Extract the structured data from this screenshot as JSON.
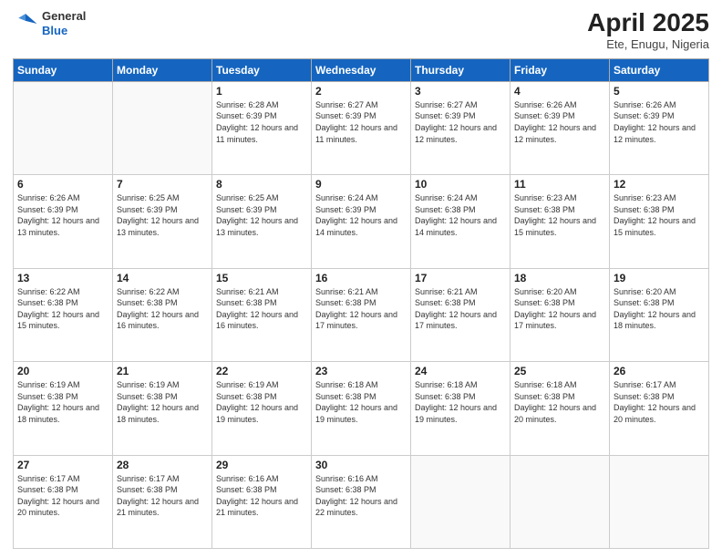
{
  "header": {
    "logo_general": "General",
    "logo_blue": "Blue",
    "month_year": "April 2025",
    "location": "Ete, Enugu, Nigeria"
  },
  "days_of_week": [
    "Sunday",
    "Monday",
    "Tuesday",
    "Wednesday",
    "Thursday",
    "Friday",
    "Saturday"
  ],
  "weeks": [
    [
      {
        "day": "",
        "info": ""
      },
      {
        "day": "",
        "info": ""
      },
      {
        "day": "1",
        "info": "Sunrise: 6:28 AM\nSunset: 6:39 PM\nDaylight: 12 hours and 11 minutes."
      },
      {
        "day": "2",
        "info": "Sunrise: 6:27 AM\nSunset: 6:39 PM\nDaylight: 12 hours and 11 minutes."
      },
      {
        "day": "3",
        "info": "Sunrise: 6:27 AM\nSunset: 6:39 PM\nDaylight: 12 hours and 12 minutes."
      },
      {
        "day": "4",
        "info": "Sunrise: 6:26 AM\nSunset: 6:39 PM\nDaylight: 12 hours and 12 minutes."
      },
      {
        "day": "5",
        "info": "Sunrise: 6:26 AM\nSunset: 6:39 PM\nDaylight: 12 hours and 12 minutes."
      }
    ],
    [
      {
        "day": "6",
        "info": "Sunrise: 6:26 AM\nSunset: 6:39 PM\nDaylight: 12 hours and 13 minutes."
      },
      {
        "day": "7",
        "info": "Sunrise: 6:25 AM\nSunset: 6:39 PM\nDaylight: 12 hours and 13 minutes."
      },
      {
        "day": "8",
        "info": "Sunrise: 6:25 AM\nSunset: 6:39 PM\nDaylight: 12 hours and 13 minutes."
      },
      {
        "day": "9",
        "info": "Sunrise: 6:24 AM\nSunset: 6:39 PM\nDaylight: 12 hours and 14 minutes."
      },
      {
        "day": "10",
        "info": "Sunrise: 6:24 AM\nSunset: 6:38 PM\nDaylight: 12 hours and 14 minutes."
      },
      {
        "day": "11",
        "info": "Sunrise: 6:23 AM\nSunset: 6:38 PM\nDaylight: 12 hours and 15 minutes."
      },
      {
        "day": "12",
        "info": "Sunrise: 6:23 AM\nSunset: 6:38 PM\nDaylight: 12 hours and 15 minutes."
      }
    ],
    [
      {
        "day": "13",
        "info": "Sunrise: 6:22 AM\nSunset: 6:38 PM\nDaylight: 12 hours and 15 minutes."
      },
      {
        "day": "14",
        "info": "Sunrise: 6:22 AM\nSunset: 6:38 PM\nDaylight: 12 hours and 16 minutes."
      },
      {
        "day": "15",
        "info": "Sunrise: 6:21 AM\nSunset: 6:38 PM\nDaylight: 12 hours and 16 minutes."
      },
      {
        "day": "16",
        "info": "Sunrise: 6:21 AM\nSunset: 6:38 PM\nDaylight: 12 hours and 17 minutes."
      },
      {
        "day": "17",
        "info": "Sunrise: 6:21 AM\nSunset: 6:38 PM\nDaylight: 12 hours and 17 minutes."
      },
      {
        "day": "18",
        "info": "Sunrise: 6:20 AM\nSunset: 6:38 PM\nDaylight: 12 hours and 17 minutes."
      },
      {
        "day": "19",
        "info": "Sunrise: 6:20 AM\nSunset: 6:38 PM\nDaylight: 12 hours and 18 minutes."
      }
    ],
    [
      {
        "day": "20",
        "info": "Sunrise: 6:19 AM\nSunset: 6:38 PM\nDaylight: 12 hours and 18 minutes."
      },
      {
        "day": "21",
        "info": "Sunrise: 6:19 AM\nSunset: 6:38 PM\nDaylight: 12 hours and 18 minutes."
      },
      {
        "day": "22",
        "info": "Sunrise: 6:19 AM\nSunset: 6:38 PM\nDaylight: 12 hours and 19 minutes."
      },
      {
        "day": "23",
        "info": "Sunrise: 6:18 AM\nSunset: 6:38 PM\nDaylight: 12 hours and 19 minutes."
      },
      {
        "day": "24",
        "info": "Sunrise: 6:18 AM\nSunset: 6:38 PM\nDaylight: 12 hours and 19 minutes."
      },
      {
        "day": "25",
        "info": "Sunrise: 6:18 AM\nSunset: 6:38 PM\nDaylight: 12 hours and 20 minutes."
      },
      {
        "day": "26",
        "info": "Sunrise: 6:17 AM\nSunset: 6:38 PM\nDaylight: 12 hours and 20 minutes."
      }
    ],
    [
      {
        "day": "27",
        "info": "Sunrise: 6:17 AM\nSunset: 6:38 PM\nDaylight: 12 hours and 20 minutes."
      },
      {
        "day": "28",
        "info": "Sunrise: 6:17 AM\nSunset: 6:38 PM\nDaylight: 12 hours and 21 minutes."
      },
      {
        "day": "29",
        "info": "Sunrise: 6:16 AM\nSunset: 6:38 PM\nDaylight: 12 hours and 21 minutes."
      },
      {
        "day": "30",
        "info": "Sunrise: 6:16 AM\nSunset: 6:38 PM\nDaylight: 12 hours and 22 minutes."
      },
      {
        "day": "",
        "info": ""
      },
      {
        "day": "",
        "info": ""
      },
      {
        "day": "",
        "info": ""
      }
    ]
  ]
}
